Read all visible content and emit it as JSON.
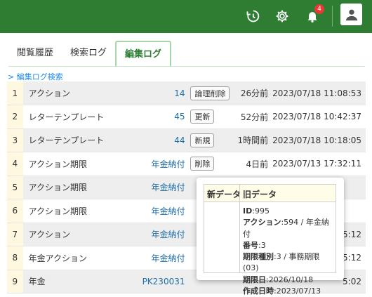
{
  "topbar": {
    "history_icon": "history-icon",
    "settings_icon": "gear-icon",
    "bell_icon": "bell-icon",
    "notification_count": "4",
    "user_icon": "user-icon"
  },
  "tabs": [
    {
      "label": "閲覧履歴"
    },
    {
      "label": "検索ログ"
    },
    {
      "label": "編集ログ"
    }
  ],
  "search_link": "> 編集ログ検索",
  "rows": [
    {
      "idx": "1",
      "action": "アクション",
      "link": "14",
      "tag": "論理削除",
      "ago": "26分前",
      "datetime": "2023/07/18 11:08:53"
    },
    {
      "idx": "2",
      "action": "レターテンプレート",
      "link": "45",
      "tag": "更新",
      "ago": "52分前",
      "datetime": "2023/07/18 10:42:37"
    },
    {
      "idx": "3",
      "action": "レターテンプレート",
      "link": "44",
      "tag": "新規",
      "ago": "1時間前",
      "datetime": "2023/07/18 10:18:05"
    },
    {
      "idx": "4",
      "action": "アクション期限",
      "link": "年金納付",
      "tag": "削除",
      "ago": "4日前",
      "datetime": "2023/07/13 17:32:11"
    },
    {
      "idx": "5",
      "action": "アクション期限",
      "link": "年金納付",
      "tag": "",
      "ago": "",
      "datetime": ""
    },
    {
      "idx": "6",
      "action": "アクション期限",
      "link": "年金納付",
      "tag": "",
      "ago": "",
      "datetime": ""
    },
    {
      "idx": "7",
      "action": "アクション",
      "link": "年金納付",
      "tag": "",
      "ago": "",
      "datetime": "5:12"
    },
    {
      "idx": "8",
      "action": "年金アクション",
      "link": "年金納付",
      "tag": "",
      "ago": "",
      "datetime": "5:12"
    },
    {
      "idx": "9",
      "action": "年金",
      "link": "PK230031",
      "tag": "",
      "ago": "",
      "datetime": "5:02"
    }
  ],
  "popover": {
    "col_new": "新データ",
    "col_old": "旧データ",
    "lines": [
      {
        "key": "ID",
        "val": ":995"
      },
      {
        "key": "アクション",
        "val": ":594 / 年金納付"
      },
      {
        "key": "番号",
        "val": ":3"
      },
      {
        "key": "期限種別",
        "val": ":3 / 事務期限 (03)"
      },
      {
        "key": "期限日",
        "val": ":2026/10/18"
      },
      {
        "key": "作成日時",
        "val": ":2023/07/13"
      }
    ]
  }
}
